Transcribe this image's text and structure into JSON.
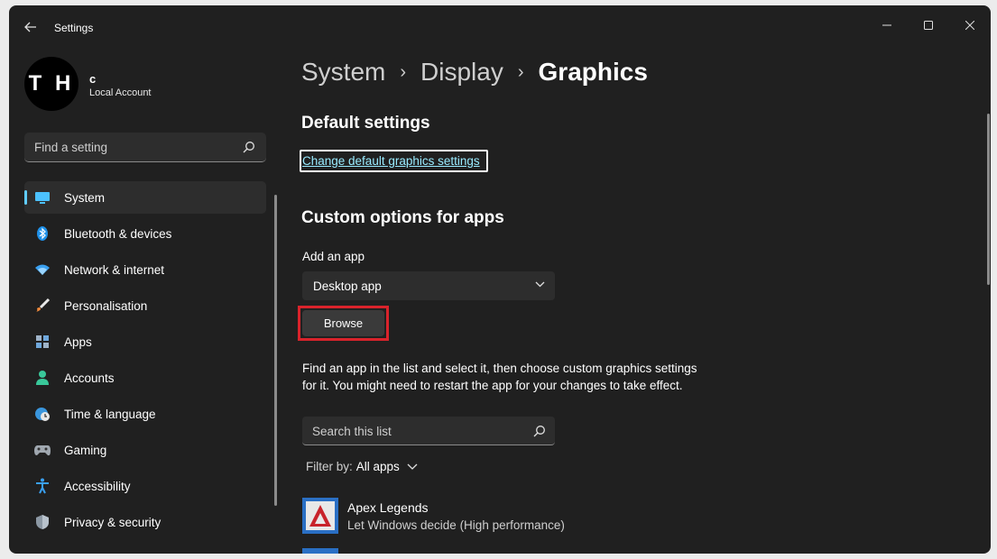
{
  "window": {
    "app_title": "Settings",
    "controls": [
      "minimize-icon",
      "maximize-icon",
      "close-icon"
    ]
  },
  "user": {
    "avatar_text": "T H",
    "name": "c",
    "account_type": "Local Account"
  },
  "sidebar": {
    "search_placeholder": "Find a setting",
    "items": [
      {
        "label": "System",
        "icon": "monitor-icon",
        "active": true
      },
      {
        "label": "Bluetooth & devices",
        "icon": "bluetooth-icon"
      },
      {
        "label": "Network & internet",
        "icon": "wifi-icon"
      },
      {
        "label": "Personalisation",
        "icon": "brush-icon"
      },
      {
        "label": "Apps",
        "icon": "apps-icon"
      },
      {
        "label": "Accounts",
        "icon": "person-icon"
      },
      {
        "label": "Time & language",
        "icon": "globe-clock-icon"
      },
      {
        "label": "Gaming",
        "icon": "gamepad-icon"
      },
      {
        "label": "Accessibility",
        "icon": "accessibility-icon"
      },
      {
        "label": "Privacy & security",
        "icon": "shield-icon"
      }
    ]
  },
  "breadcrumb": {
    "items": [
      "System",
      "Display",
      "Graphics"
    ],
    "separator": "›"
  },
  "main": {
    "default_settings_title": "Default settings",
    "change_default_link": "Change default graphics settings",
    "custom_options_title": "Custom options for apps",
    "add_app_label": "Add an app",
    "app_type_selected": "Desktop app",
    "browse_label": "Browse",
    "description": "Find an app in the list and select it, then choose custom graphics settings for it. You might need to restart the app for your changes to take effect.",
    "list_search_placeholder": "Search this list",
    "filter_label": "Filter by:",
    "filter_value": "All apps",
    "apps": [
      {
        "name": "Apex Legends",
        "setting": "Let Windows decide (High performance)"
      }
    ]
  },
  "colors": {
    "accent": "#60cdff",
    "link": "#99ebff",
    "highlight_frame": "#d9232b",
    "background": "#202020"
  }
}
